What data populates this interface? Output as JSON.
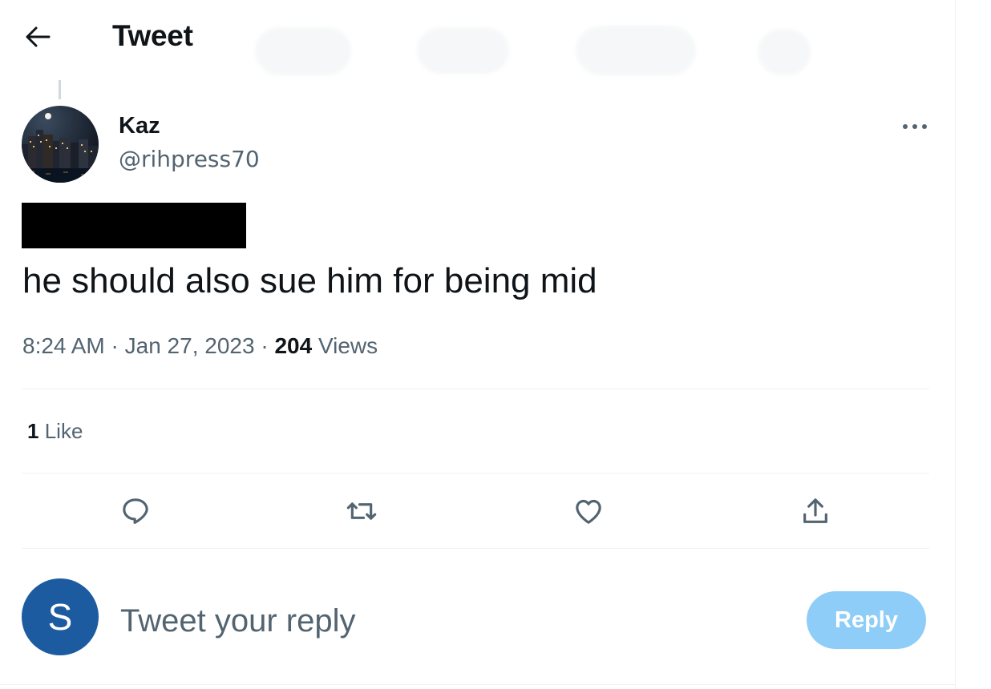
{
  "header": {
    "title": "Tweet"
  },
  "tweet": {
    "author_name": "Kaz",
    "author_handle": "@rihpress70",
    "text": "he should also sue him for being mid",
    "time": "8:24 AM",
    "date": "Jan 27, 2023",
    "views_count": "204",
    "views_label": "Views"
  },
  "stats": {
    "likes_count": "1",
    "likes_label": "Like"
  },
  "actions": {
    "reply_icon": "comment-icon",
    "retweet_icon": "retweet-icon",
    "like_icon": "heart-icon",
    "share_icon": "share-icon"
  },
  "composer": {
    "avatar_letter": "S",
    "placeholder": "Tweet your reply",
    "reply_button": "Reply"
  },
  "colors": {
    "text_primary": "#0f1419",
    "text_secondary": "#536471",
    "divider": "#eff3f4",
    "reply_button_disabled": "#8ecdf8",
    "avatar_bg": "#1d5ba0"
  }
}
